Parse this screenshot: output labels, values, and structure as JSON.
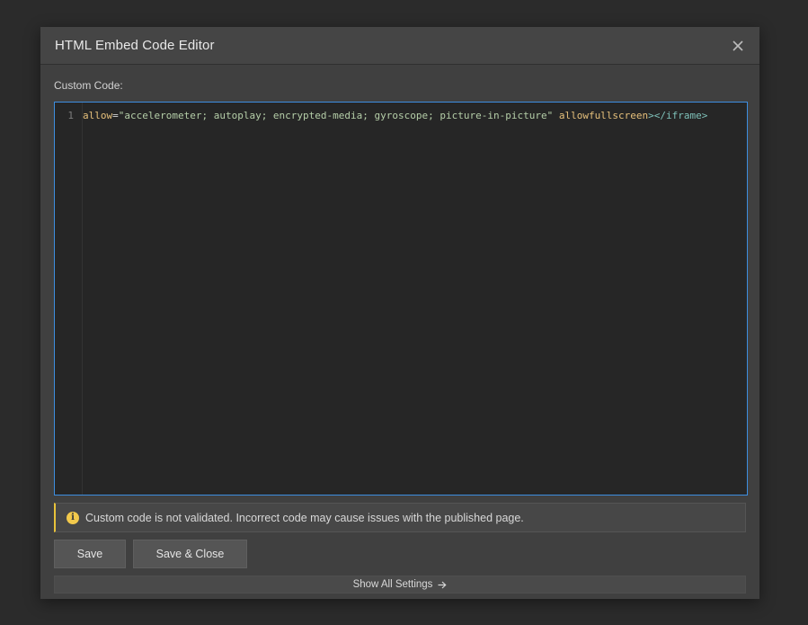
{
  "dialog": {
    "title": "HTML Embed Code Editor",
    "close_icon": "close-icon"
  },
  "editor": {
    "label": "Custom Code:",
    "lines": [
      {
        "number": "1",
        "tokens": [
          {
            "type": "attr",
            "text": "allow"
          },
          {
            "type": "eq",
            "text": "="
          },
          {
            "type": "str",
            "text": "\"accelerometer; autoplay; encrypted-media; gyroscope; picture-in-picture\""
          },
          {
            "type": "eq",
            "text": " "
          },
          {
            "type": "attr",
            "text": "allowfullscreen"
          },
          {
            "type": "tag",
            "text": "></iframe>"
          }
        ]
      }
    ]
  },
  "notice": {
    "icon": "info-icon",
    "icon_glyph": "i",
    "text": "Custom code is not validated. Incorrect code may cause issues with the published page.",
    "accent_color": "#e8c23a"
  },
  "buttons": {
    "save_label": "Save",
    "save_close_label": "Save & Close"
  },
  "footer": {
    "show_all_label": "Show All Settings",
    "arrow_icon": "arrow-right-icon"
  },
  "colors": {
    "editor_focus_border": "#3d8ee0"
  }
}
